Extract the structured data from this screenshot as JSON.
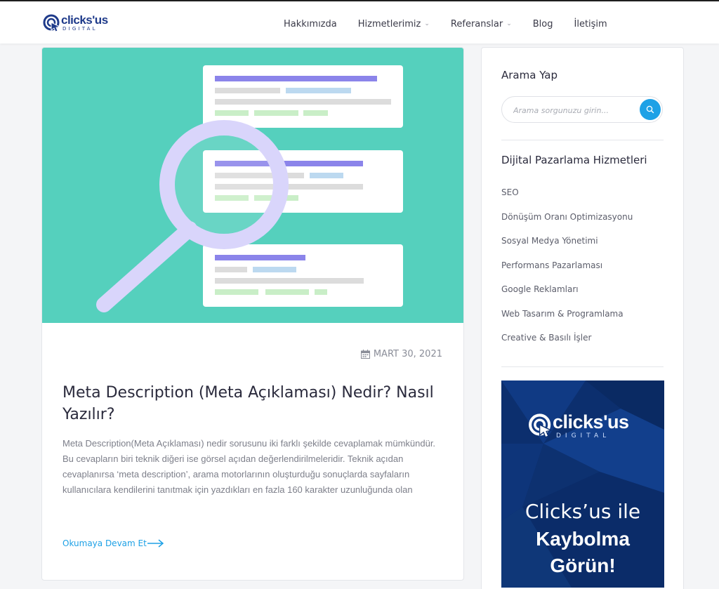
{
  "header": {
    "logo": {
      "word": "clicks'us",
      "sub": "DIGITAL"
    },
    "nav": [
      {
        "label": "Hakkımızda",
        "dropdown": false
      },
      {
        "label": "Hizmetlerimiz",
        "dropdown": true
      },
      {
        "label": "Referanslar",
        "dropdown": true
      },
      {
        "label": "Blog",
        "dropdown": false
      },
      {
        "label": "İletişim",
        "dropdown": false
      }
    ]
  },
  "post": {
    "date": "MART 30, 2021",
    "title": "Meta Description (Meta Açıklaması) Nedir? Nasıl Yazılır?",
    "excerpt": "Meta Description(Meta Açıklaması) nedir sorusunu iki farklı şekilde cevaplamak mümkündür. Bu cevapların biri teknik diğeri ise görsel açıdan değerlendirilmeleridir. Teknik açıdan cevaplanırsa ‘meta description’, arama motorlarının oluşturduğu sonuçlarda sayfaların kullanıcılara kendilerini tanıtmak için yazdıkları en fazla 160 karakter uzunluğunda olan",
    "read_more": "Okumaya Devam Et"
  },
  "sidebar": {
    "search": {
      "heading": "Arama Yap",
      "placeholder": "Arama sorgunuzu girin..."
    },
    "services": {
      "heading": "Dijital Pazarlama Hizmetleri",
      "items": [
        "SEO",
        "Dönüşüm Oranı Optimizasyonu",
        "Sosyal Medya Yönetimi",
        "Performans Pazarlaması",
        "Google Reklamları",
        "Web Tasarım & Programlama",
        "Creative & Basılı İşler"
      ]
    },
    "banner": {
      "logo_word": "clicks'us",
      "logo_sub": "DIGITAL",
      "line1": "Clicks’us ile",
      "line2": "Kaybolma",
      "line3": "Görün!"
    }
  },
  "colors": {
    "accent": "#1ea1e6",
    "hero_bg": "#55d0bd",
    "brand_navy": "#1e3a8a",
    "banner_bg": "#0c2f6e"
  },
  "icons": [
    "logo-mark-icon",
    "chevron-down-icon",
    "calendar-icon",
    "search-icon",
    "arrow-right-icon",
    "magnifier-illustration"
  ]
}
